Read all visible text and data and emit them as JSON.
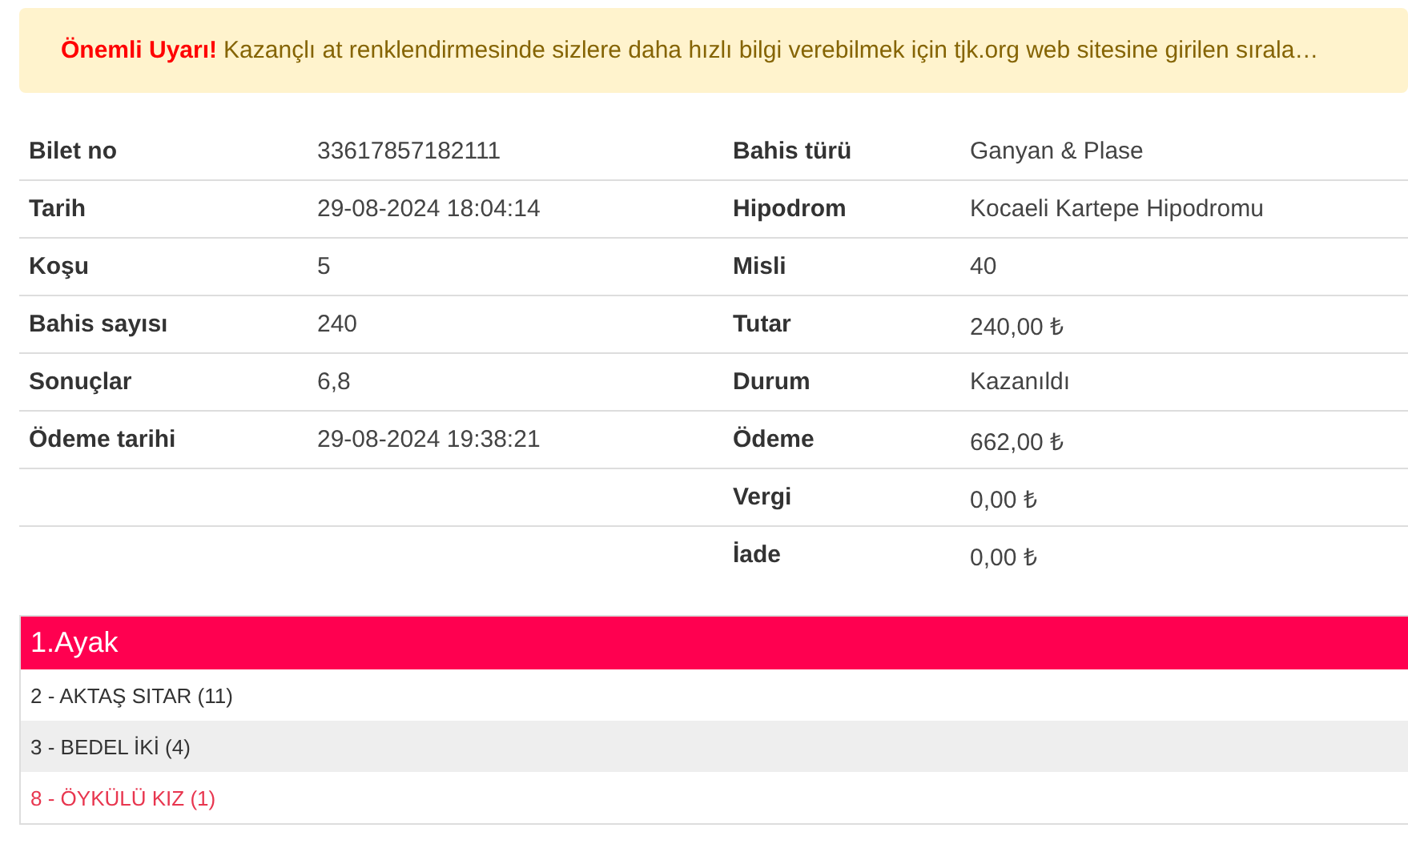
{
  "notice": {
    "label": "Önemli Uyarı!",
    "text": "Kazançlı at renklendirmesinde sizlere daha hızlı bilgi verebilmek için tjk.org web sitesine girilen sırala…"
  },
  "details": [
    {
      "left": {
        "label": "Bilet no",
        "value": "33617857182111"
      },
      "right": {
        "label": "Bahis türü",
        "value": "Ganyan & Plase"
      }
    },
    {
      "left": {
        "label": "Tarih",
        "value": "29-08-2024 18:04:14"
      },
      "right": {
        "label": "Hipodrom",
        "value": "Kocaeli Kartepe Hipodromu"
      }
    },
    {
      "left": {
        "label": "Koşu",
        "value": "5"
      },
      "right": {
        "label": "Misli",
        "value": "40"
      }
    },
    {
      "left": {
        "label": "Bahis sayısı",
        "value": "240"
      },
      "right": {
        "label": "Tutar",
        "value": "240,00 ₺"
      }
    },
    {
      "left": {
        "label": "Sonuçlar",
        "value": "6,8"
      },
      "right": {
        "label": "Durum",
        "value": "Kazanıldı"
      }
    },
    {
      "left": {
        "label": "Ödeme tarihi",
        "value": "29-08-2024 19:38:21"
      },
      "right": {
        "label": "Ödeme",
        "value": "662,00 ₺"
      }
    },
    {
      "right": {
        "label": "Vergi",
        "value": "0,00 ₺"
      }
    },
    {
      "right": {
        "label": "İade",
        "value": "0,00 ₺"
      }
    }
  ],
  "legs": [
    {
      "title": "1.Ayak",
      "horses": [
        {
          "name": "2 - AKTAŞ SITAR (11)",
          "winner": false
        },
        {
          "name": "3 - BEDEL İKİ (4)",
          "winner": false
        },
        {
          "name": "8 - ÖYKÜLÜ KIZ (1)",
          "winner": true
        }
      ]
    }
  ]
}
